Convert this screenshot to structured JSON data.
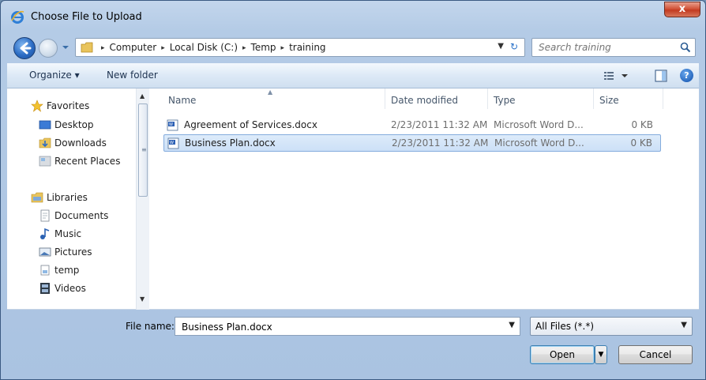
{
  "window": {
    "title": "Choose File to Upload",
    "close_label": "x"
  },
  "address": {
    "crumbs": [
      "Computer",
      "Local Disk (C:)",
      "Temp",
      "training"
    ],
    "separator": "▸"
  },
  "search": {
    "placeholder": "Search training"
  },
  "toolbar": {
    "organize_label": "Organize ▾",
    "new_folder_label": "New folder",
    "help_label": "?"
  },
  "nav": {
    "favorites": {
      "label": "Favorites",
      "items": [
        {
          "label": "Desktop",
          "icon": "desktop-icon"
        },
        {
          "label": "Downloads",
          "icon": "downloads-folder-icon"
        },
        {
          "label": "Recent Places",
          "icon": "recent-places-icon"
        }
      ]
    },
    "libraries": {
      "label": "Libraries",
      "items": [
        {
          "label": "Documents",
          "icon": "documents-icon"
        },
        {
          "label": "Music",
          "icon": "music-icon"
        },
        {
          "label": "Pictures",
          "icon": "pictures-icon"
        },
        {
          "label": "temp",
          "icon": "library-icon"
        },
        {
          "label": "Videos",
          "icon": "videos-icon"
        }
      ]
    }
  },
  "files": {
    "columns": {
      "name": "Name",
      "date": "Date modified",
      "type": "Type",
      "size": "Size"
    },
    "rows": [
      {
        "name": "Agreement of Services.docx",
        "date": "2/23/2011 11:32 AM",
        "type": "Microsoft Word D...",
        "size": "0 KB",
        "selected": false
      },
      {
        "name": "Business Plan.docx",
        "date": "2/23/2011 11:32 AM",
        "type": "Microsoft Word D...",
        "size": "0 KB",
        "selected": true
      }
    ]
  },
  "footer": {
    "file_name_label": "File name:",
    "file_name_value": "Business Plan.docx",
    "filter_value": "All Files (*.*)",
    "open_label": "Open",
    "cancel_label": "Cancel"
  },
  "colors": {
    "selection": "#cce0f7",
    "accent": "#2c6cc4",
    "close": "#c23b21"
  }
}
